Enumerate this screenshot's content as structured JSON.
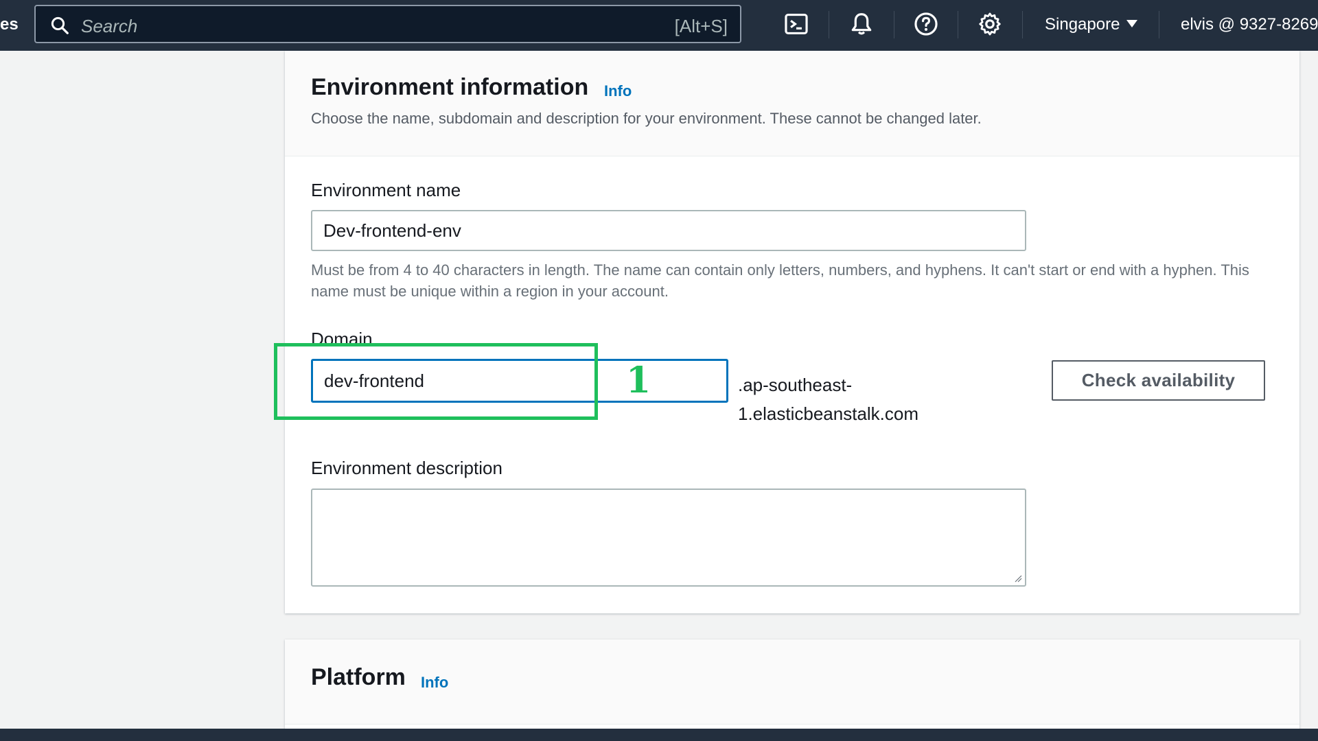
{
  "topnav": {
    "clipped_text": "es",
    "search_placeholder": "Search",
    "search_shortcut": "[Alt+S]",
    "icons": [
      "cloudshell-icon",
      "bell-icon",
      "help-icon",
      "gear-icon"
    ],
    "region": "Singapore",
    "user": "elvis @ 9327-8269"
  },
  "environment_info": {
    "title": "Environment information",
    "info_link": "Info",
    "description": "Choose the name, subdomain and description for your environment. These cannot be changed later.",
    "env_name_label": "Environment name",
    "env_name_value": "Dev-frontend-env",
    "env_name_hint": "Must be from 4 to 40 characters in length. The name can contain only letters, numbers, and hyphens. It can't start or end with a hyphen. This name must be unique within a region in your account.",
    "domain_label": "Domain",
    "domain_value": "dev-frontend",
    "domain_suffix_line1": ".ap-southeast-",
    "domain_suffix_line2": "1.elasticbeanstalk.com",
    "check_button": "Check availability",
    "env_desc_label": "Environment description",
    "env_desc_value": ""
  },
  "platform": {
    "title": "Platform",
    "info_link": "Info"
  },
  "annotation": {
    "label": "1",
    "color": "#1fbf5c"
  },
  "colors": {
    "nav_bg": "#232f3e",
    "link": "#0073bb",
    "focus_border": "#0073bb"
  }
}
